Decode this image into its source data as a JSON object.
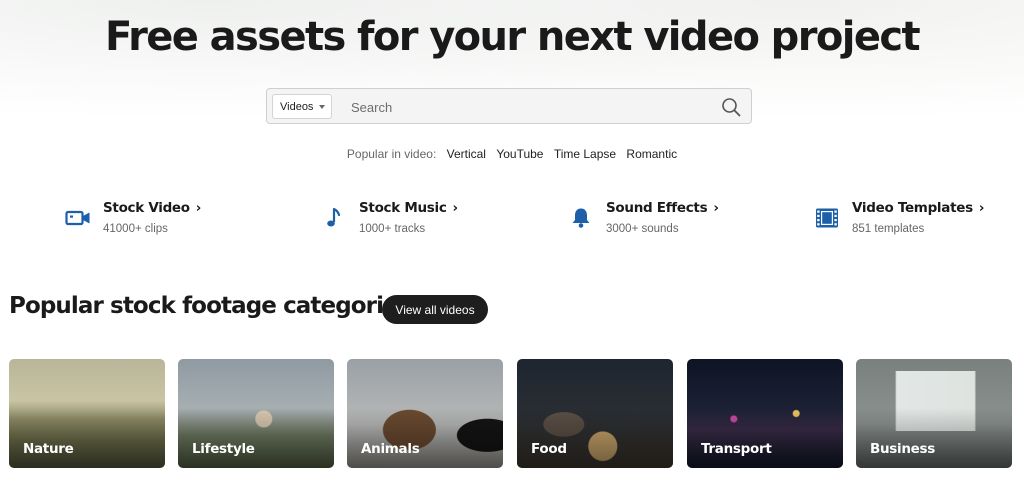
{
  "hero": {
    "title": "Free assets for your next video project"
  },
  "search": {
    "type_label": "Videos",
    "placeholder": "Search"
  },
  "popular": {
    "label": "Popular in video:",
    "tags": [
      "Vertical",
      "YouTube",
      "Time Lapse",
      "Romantic"
    ]
  },
  "asset_types": [
    {
      "title": "Stock Video",
      "count": "41000+ clips",
      "icon": "video-camera-icon"
    },
    {
      "title": "Stock Music",
      "count": "1000+ tracks",
      "icon": "music-note-icon"
    },
    {
      "title": "Sound Effects",
      "count": "3000+ sounds",
      "icon": "bell-icon"
    },
    {
      "title": "Video Templates",
      "count": "851 templates",
      "icon": "film-strip-icon"
    }
  ],
  "categories_section": {
    "title": "Popular stock footage categories",
    "view_all_label": "View all videos",
    "cards": [
      {
        "label": "Nature"
      },
      {
        "label": "Lifestyle"
      },
      {
        "label": "Animals"
      },
      {
        "label": "Food"
      },
      {
        "label": "Transport"
      },
      {
        "label": "Business"
      }
    ]
  },
  "colors": {
    "icon_blue": "#1d5fa8",
    "dark_button": "#1e1e1e",
    "title_text": "#1a1a1a"
  }
}
